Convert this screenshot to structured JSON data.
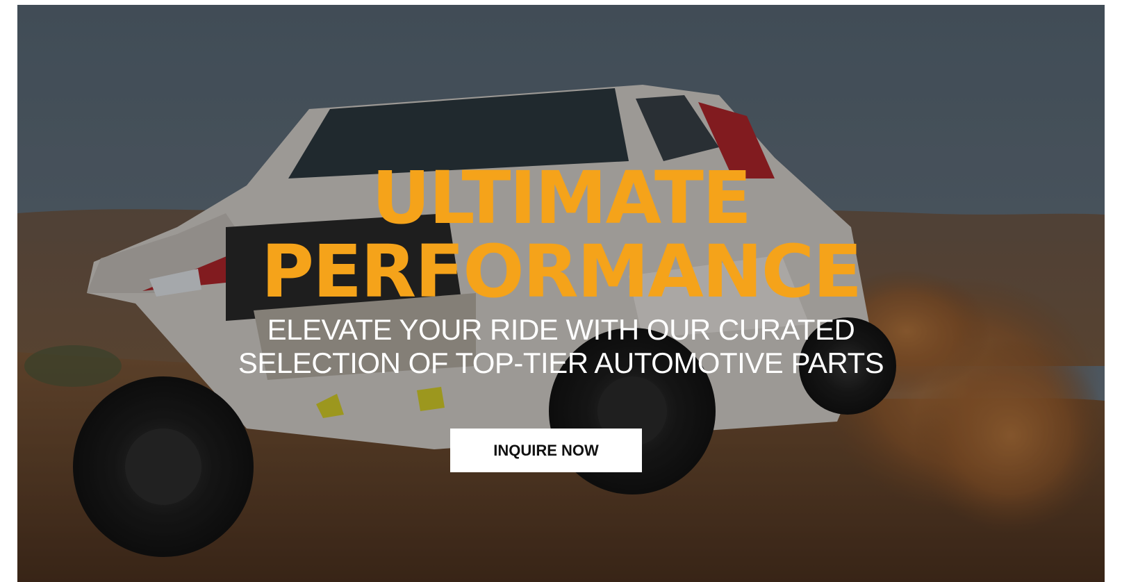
{
  "hero": {
    "headline_line1": "ULTIMATE",
    "headline_line2": "PERFORMANCE",
    "subtitle_line1": "ELEVATE YOUR RIDE WITH OUR CURATED",
    "subtitle_line2": "SELECTION OF TOP-TIER AUTOMOTIVE PARTS",
    "cta_label": "INQUIRE NOW",
    "background_image": "rally-truck-desert-photo"
  },
  "colors": {
    "headline": "#F5A31A",
    "subtitle": "#FFFFFF",
    "cta_background": "#FFFFFF",
    "cta_text": "#111111",
    "sky": "#5E6E7C",
    "dirt": "#8A5A34"
  }
}
